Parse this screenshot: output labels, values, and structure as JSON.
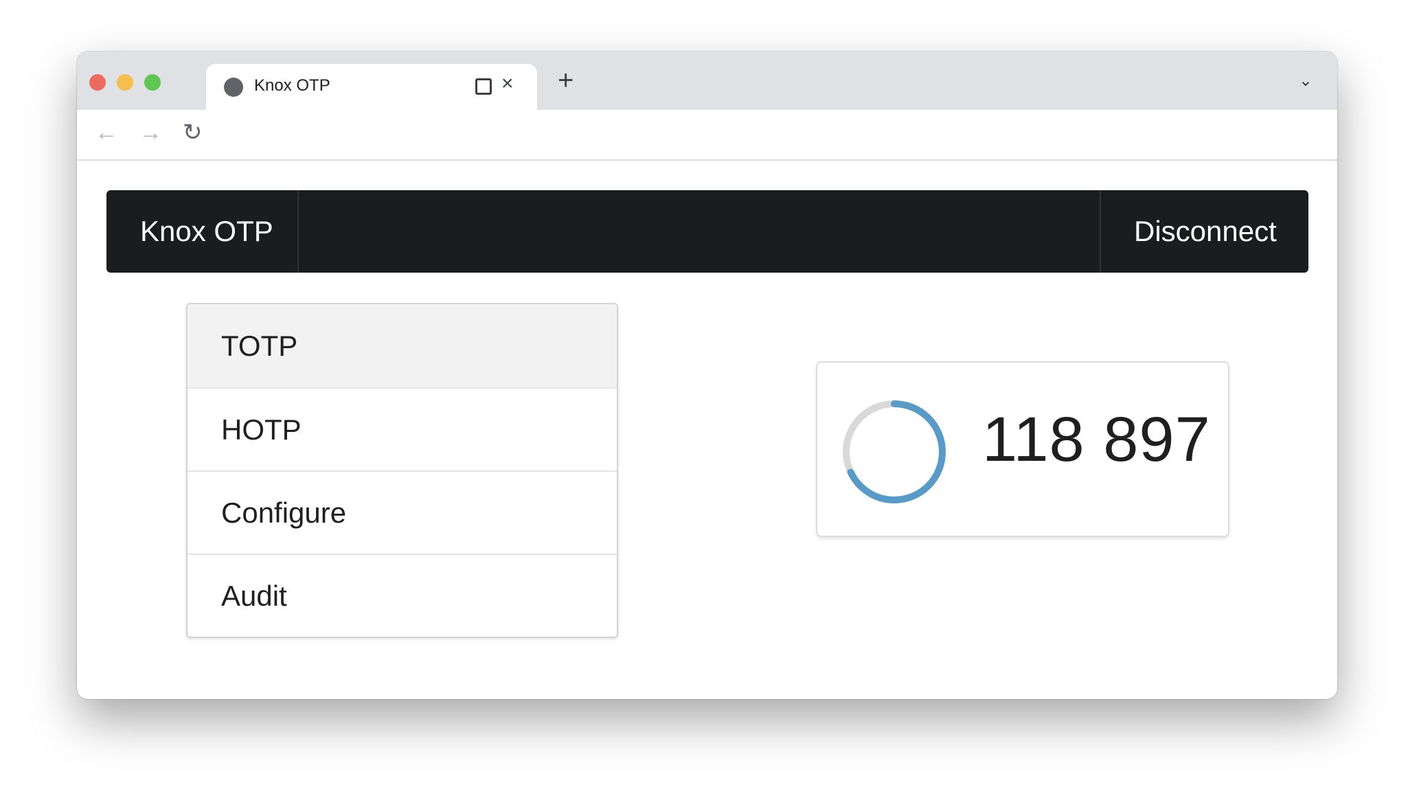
{
  "browser": {
    "tab_title": "Knox OTP",
    "close_icon": "×",
    "new_tab_icon": "+",
    "chevron_icon": "⌄",
    "back_icon": "←",
    "forward_icon": "→",
    "reload_icon": "↻"
  },
  "navbar": {
    "brand": "Knox OTP",
    "disconnect": "Disconnect"
  },
  "menu": {
    "items": [
      {
        "label": "TOTP"
      },
      {
        "label": "HOTP"
      },
      {
        "label": "Configure"
      },
      {
        "label": "Audit"
      }
    ]
  },
  "otp": {
    "code": "118 897",
    "progress": 0.68,
    "progress_color": "#5a9ac6",
    "track_color": "#d8d8d8"
  }
}
